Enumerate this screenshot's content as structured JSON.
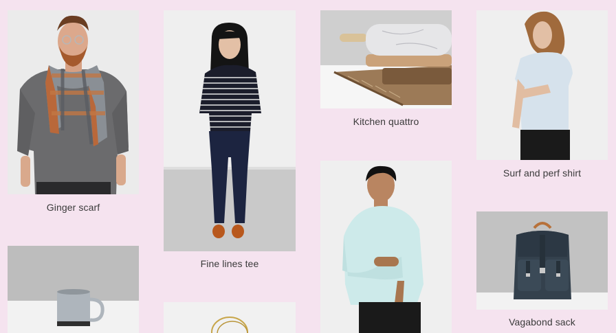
{
  "products": [
    {
      "name": "Ginger scarf"
    },
    {
      "name": "Fine lines tee"
    },
    {
      "name": "Kitchen quattro"
    },
    {
      "name": "Surf and perf shirt"
    },
    {
      "name": "Vagabond sack"
    }
  ],
  "images": {
    "ginger_scarf": "man-wearing-plaid-scarf-photo",
    "fine_lines_tee": "woman-in-striped-shirt-photo",
    "kitchen_quattro": "rolling-pin-and-boards-photo",
    "surf_perf_shirt": "man-in-light-blue-tee-photo",
    "mug": "grey-mug-photo",
    "sweater": "man-in-mint-sweater-photo",
    "jewelry": "gold-bracelets-photo",
    "vagabond_sack": "dark-backpack-photo"
  }
}
